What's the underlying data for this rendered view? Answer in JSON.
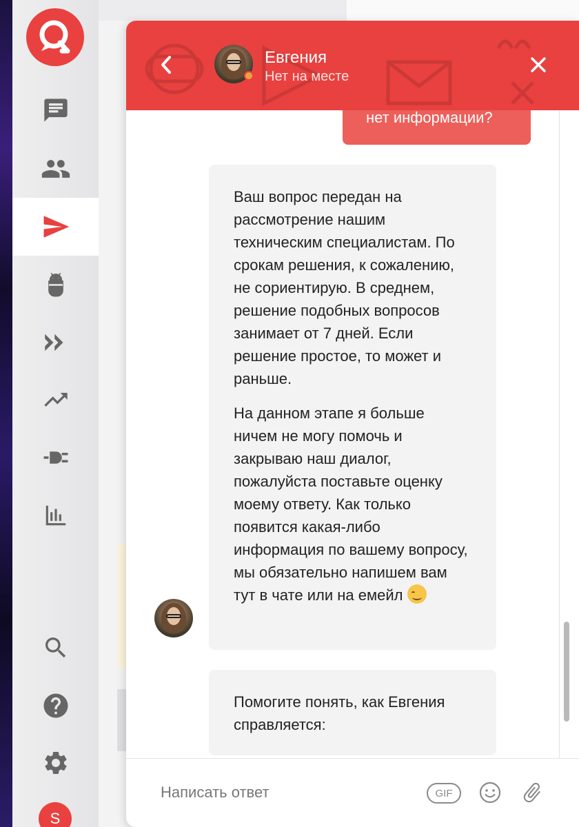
{
  "sidebar": {
    "nav_items": [
      {
        "name": "conversations",
        "icon": "chat-icon"
      },
      {
        "name": "visitors",
        "icon": "people-icon"
      },
      {
        "name": "messages",
        "icon": "send-icon",
        "active": true
      },
      {
        "name": "bots",
        "icon": "android-icon"
      },
      {
        "name": "triggers",
        "icon": "fast-forward-icon"
      },
      {
        "name": "growth",
        "icon": "trending-up-icon"
      },
      {
        "name": "integrations",
        "icon": "plug-icon"
      },
      {
        "name": "reports",
        "icon": "bar-chart-icon"
      }
    ],
    "bottom_items": [
      {
        "name": "search",
        "icon": "search-icon"
      },
      {
        "name": "help",
        "icon": "help-icon"
      },
      {
        "name": "settings",
        "icon": "gear-icon"
      }
    ],
    "user_avatar_letter": "S"
  },
  "chat": {
    "agent_name": "Евгения",
    "agent_status": "Нет на месте",
    "messages": {
      "user_partial": "нет информации?",
      "bot_paragraph_1": "Ваш вопрос передан на рассмотрение нашим техническим специалистам. По срокам решения, к сожалению, не сориентирую. В среднем, решение подобных вопросов занимает от 7 дней. Если решение простое, то может и раньше.",
      "bot_paragraph_2": "На данном этапе я больше ничем не могу помочь и закрываю наш диалог, пожалуйста поставьте оценку моему ответу. Как только появится какая-либо информация по вашему вопросу, мы обязательно напишем вам тут в чате или на емейл",
      "bot_rating_prompt": "Помогите понять, как Евгения справляется:"
    },
    "composer": {
      "placeholder": "Написать ответ",
      "gif_label": "GIF"
    }
  },
  "colors": {
    "brand": "#e8413f",
    "user_bubble": "#ec5f5a",
    "bot_bubble": "#f3f3f4",
    "status_away": "#f0a03a"
  }
}
